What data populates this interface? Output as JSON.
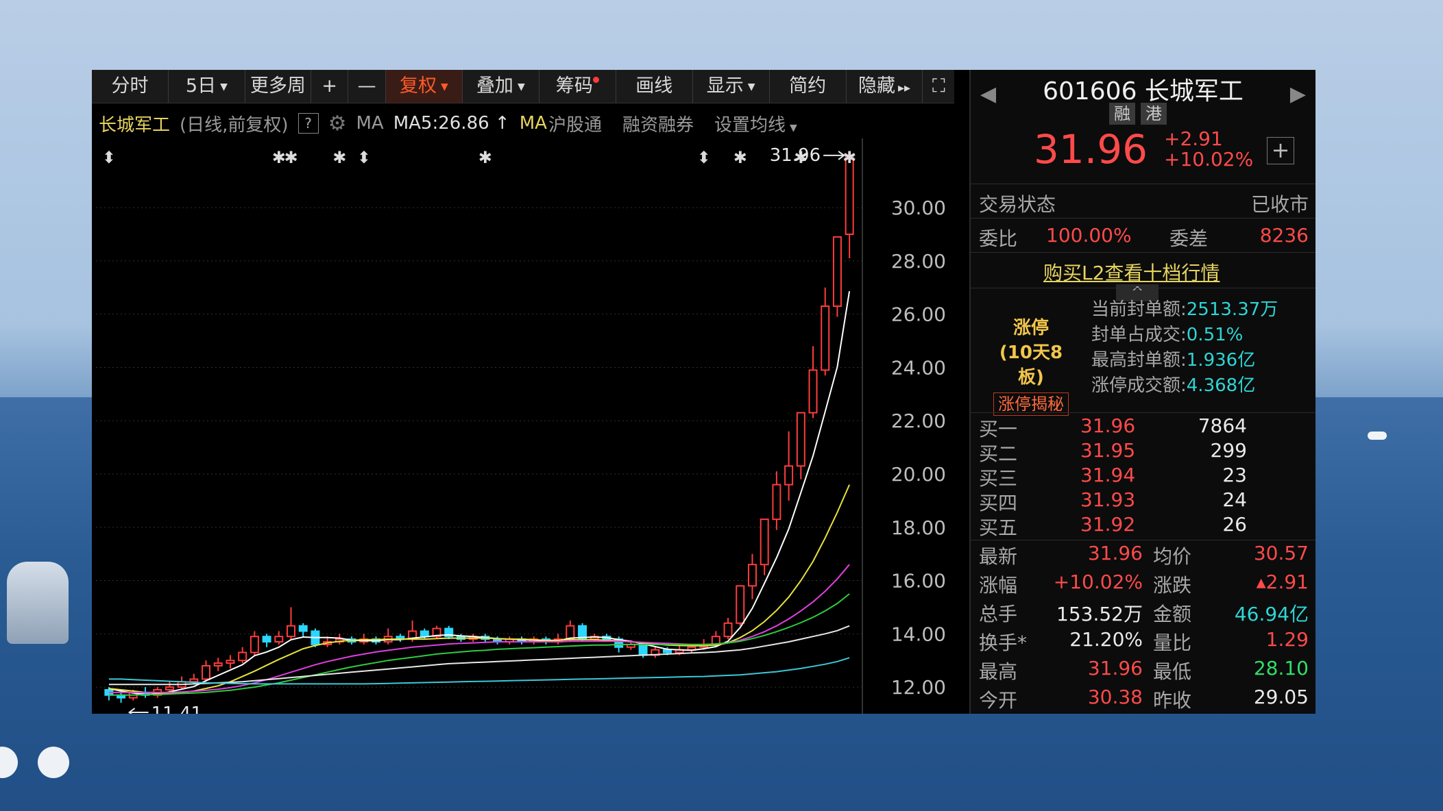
{
  "toolbar": {
    "fenshi": "分时",
    "fiveday": "5日",
    "more": "更多周",
    "plus": "+",
    "minus": "—",
    "fuquan": "复权",
    "overlay": "叠加",
    "chouma": "筹码",
    "draw": "画线",
    "display": "显示",
    "simple": "简约",
    "hide": "隐藏",
    "hide_arrows": "▸▸",
    "expand": "⛶"
  },
  "info": {
    "name": "长城军工",
    "sub": "(日线,前复权)",
    "help": "?",
    "ma_label": "MA",
    "ma5": "MA5:26.86",
    "ma5_arrow": "↑",
    "ma_yellow": "MA",
    "hgt": "沪股通",
    "margin": "融资融券",
    "set_ma": "设置均线"
  },
  "chart_data": {
    "type": "candlestick",
    "ylim": [
      11,
      32.6
    ],
    "y_ticks": [
      "30.00",
      "28.00",
      "26.00",
      "24.00",
      "22.00",
      "20.00",
      "18.00",
      "16.00",
      "14.00",
      "12.00"
    ],
    "y_tick_values": [
      30,
      28,
      26,
      24,
      22,
      20,
      18,
      16,
      14,
      12
    ],
    "last_label": "31.96",
    "low_label": "11.41",
    "candles": [
      [
        11.9,
        11.7,
        12.0,
        11.5
      ],
      [
        11.7,
        11.6,
        11.8,
        11.41
      ],
      [
        11.6,
        11.8,
        11.9,
        11.5
      ],
      [
        11.8,
        11.7,
        12.0,
        11.6
      ],
      [
        11.7,
        11.9,
        12.0,
        11.6
      ],
      [
        11.9,
        12.0,
        12.2,
        11.8
      ],
      [
        12.0,
        12.2,
        12.4,
        11.9
      ],
      [
        12.2,
        12.3,
        12.5,
        12.1
      ],
      [
        12.3,
        12.8,
        13.0,
        12.2
      ],
      [
        12.8,
        12.9,
        13.1,
        12.6
      ],
      [
        12.9,
        13.0,
        13.2,
        12.7
      ],
      [
        13.0,
        13.3,
        13.5,
        12.9
      ],
      [
        13.3,
        13.9,
        14.1,
        13.2
      ],
      [
        13.9,
        13.7,
        14.0,
        13.5
      ],
      [
        13.7,
        13.9,
        14.1,
        13.6
      ],
      [
        13.9,
        14.3,
        15.0,
        13.8
      ],
      [
        14.3,
        14.1,
        14.4,
        13.9
      ],
      [
        14.1,
        13.6,
        14.2,
        13.5
      ],
      [
        13.6,
        13.7,
        13.9,
        13.5
      ],
      [
        13.7,
        13.8,
        14.0,
        13.6
      ],
      [
        13.8,
        13.7,
        13.9,
        13.6
      ],
      [
        13.7,
        13.8,
        14.0,
        13.6
      ],
      [
        13.8,
        13.7,
        13.9,
        13.6
      ],
      [
        13.7,
        13.9,
        14.2,
        13.6
      ],
      [
        13.9,
        13.8,
        14.0,
        13.7
      ],
      [
        13.8,
        14.1,
        14.5,
        13.7
      ],
      [
        14.1,
        13.9,
        14.2,
        13.8
      ],
      [
        13.9,
        14.2,
        14.3,
        13.8
      ],
      [
        14.2,
        13.9,
        14.3,
        13.8
      ],
      [
        13.9,
        13.8,
        14.0,
        13.7
      ],
      [
        13.8,
        13.9,
        14.0,
        13.7
      ],
      [
        13.9,
        13.8,
        14.0,
        13.7
      ],
      [
        13.8,
        13.7,
        13.9,
        13.6
      ],
      [
        13.7,
        13.8,
        13.9,
        13.6
      ],
      [
        13.8,
        13.7,
        13.9,
        13.6
      ],
      [
        13.7,
        13.8,
        13.9,
        13.6
      ],
      [
        13.8,
        13.7,
        13.9,
        13.6
      ],
      [
        13.7,
        13.8,
        14.0,
        13.6
      ],
      [
        13.8,
        14.3,
        14.5,
        13.7
      ],
      [
        14.3,
        13.8,
        14.4,
        13.7
      ],
      [
        13.8,
        13.9,
        14.0,
        13.7
      ],
      [
        13.9,
        13.8,
        14.0,
        13.7
      ],
      [
        13.8,
        13.5,
        13.9,
        13.3
      ],
      [
        13.5,
        13.6,
        13.7,
        13.4
      ],
      [
        13.6,
        13.2,
        13.7,
        13.1
      ],
      [
        13.2,
        13.4,
        13.5,
        13.1
      ],
      [
        13.4,
        13.3,
        13.5,
        13.2
      ],
      [
        13.3,
        13.4,
        13.6,
        13.2
      ],
      [
        13.4,
        13.5,
        13.6,
        13.3
      ],
      [
        13.5,
        13.6,
        13.8,
        13.4
      ],
      [
        13.6,
        13.9,
        14.1,
        13.5
      ],
      [
        13.9,
        14.4,
        14.6,
        13.8
      ],
      [
        14.4,
        15.8,
        15.8,
        14.3
      ],
      [
        15.8,
        16.6,
        17.0,
        15.3
      ],
      [
        16.6,
        18.3,
        18.3,
        16.2
      ],
      [
        18.3,
        19.6,
        20.1,
        17.9
      ],
      [
        19.6,
        20.3,
        21.6,
        19.0
      ],
      [
        20.3,
        22.3,
        22.3,
        19.8
      ],
      [
        22.3,
        23.9,
        24.8,
        22.1
      ],
      [
        23.9,
        26.3,
        27.0,
        23.7
      ],
      [
        26.3,
        28.9,
        28.9,
        25.9
      ],
      [
        29.0,
        31.96,
        31.96,
        28.1
      ]
    ],
    "ma_series": [
      {
        "color": "#ffffff",
        "values": [
          11.95,
          11.85,
          11.78,
          11.72,
          11.74,
          11.82,
          11.92,
          12.02,
          12.24,
          12.44,
          12.64,
          12.84,
          13.18,
          13.32,
          13.5,
          13.78,
          13.88,
          13.86,
          13.86,
          13.84,
          13.76,
          13.74,
          13.74,
          13.78,
          13.78,
          13.84,
          13.88,
          13.94,
          13.96,
          13.92,
          13.9,
          13.86,
          13.82,
          13.8,
          13.78,
          13.76,
          13.74,
          13.74,
          13.84,
          13.86,
          13.88,
          13.86,
          13.78,
          13.72,
          13.62,
          13.52,
          13.42,
          13.4,
          13.38,
          13.44,
          13.52,
          13.72,
          14.24,
          14.96,
          15.9,
          16.86,
          17.94,
          19.3,
          20.68,
          22.34,
          24.02,
          26.86
        ]
      },
      {
        "color": "#e8e33c",
        "values": [
          11.95,
          11.9,
          11.85,
          11.8,
          11.78,
          11.78,
          11.8,
          11.85,
          11.95,
          12.05,
          12.2,
          12.4,
          12.6,
          12.82,
          13.04,
          13.24,
          13.44,
          13.56,
          13.66,
          13.72,
          13.76,
          13.78,
          13.78,
          13.8,
          13.8,
          13.8,
          13.8,
          13.82,
          13.84,
          13.84,
          13.84,
          13.84,
          13.82,
          13.8,
          13.8,
          13.78,
          13.76,
          13.76,
          13.78,
          13.78,
          13.78,
          13.76,
          13.74,
          13.7,
          13.66,
          13.62,
          13.58,
          13.56,
          13.55,
          13.55,
          13.58,
          13.66,
          13.86,
          14.12,
          14.46,
          14.88,
          15.38,
          16.0,
          16.72,
          17.6,
          18.56,
          19.6
        ]
      },
      {
        "color": "#e040e0",
        "values": [
          11.8,
          11.8,
          11.8,
          11.8,
          11.8,
          11.8,
          11.82,
          11.84,
          11.88,
          11.92,
          11.98,
          12.06,
          12.16,
          12.28,
          12.42,
          12.56,
          12.7,
          12.84,
          12.96,
          13.06,
          13.16,
          13.24,
          13.32,
          13.38,
          13.44,
          13.5,
          13.54,
          13.58,
          13.62,
          13.64,
          13.66,
          13.68,
          13.7,
          13.7,
          13.7,
          13.7,
          13.7,
          13.7,
          13.72,
          13.72,
          13.72,
          13.72,
          13.72,
          13.7,
          13.68,
          13.66,
          13.64,
          13.62,
          13.6,
          13.6,
          13.62,
          13.66,
          13.76,
          13.9,
          14.08,
          14.3,
          14.56,
          14.86,
          15.2,
          15.6,
          16.06,
          16.6
        ]
      },
      {
        "color": "#2ecc40",
        "values": [
          11.7,
          11.7,
          11.7,
          11.72,
          11.72,
          11.74,
          11.76,
          11.78,
          11.8,
          11.84,
          11.88,
          11.94,
          12.0,
          12.08,
          12.16,
          12.26,
          12.36,
          12.46,
          12.56,
          12.66,
          12.76,
          12.84,
          12.92,
          13.0,
          13.06,
          13.12,
          13.18,
          13.24,
          13.28,
          13.32,
          13.36,
          13.38,
          13.42,
          13.44,
          13.46,
          13.48,
          13.5,
          13.52,
          13.54,
          13.56,
          13.58,
          13.58,
          13.6,
          13.6,
          13.6,
          13.6,
          13.6,
          13.6,
          13.6,
          13.6,
          13.62,
          13.66,
          13.72,
          13.82,
          13.94,
          14.08,
          14.24,
          14.42,
          14.62,
          14.86,
          15.14,
          15.5
        ]
      },
      {
        "color": "#e8e8e8",
        "values": [
          12.1,
          12.1,
          12.1,
          12.1,
          12.1,
          12.1,
          12.1,
          12.12,
          12.14,
          12.16,
          12.18,
          12.2,
          12.24,
          12.28,
          12.32,
          12.36,
          12.4,
          12.44,
          12.48,
          12.52,
          12.56,
          12.6,
          12.64,
          12.68,
          12.72,
          12.76,
          12.8,
          12.84,
          12.88,
          12.9,
          12.92,
          12.94,
          12.96,
          12.98,
          13.0,
          13.02,
          13.04,
          13.06,
          13.08,
          13.1,
          13.12,
          13.14,
          13.16,
          13.18,
          13.2,
          13.22,
          13.24,
          13.26,
          13.28,
          13.3,
          13.32,
          13.36,
          13.4,
          13.46,
          13.54,
          13.62,
          13.7,
          13.8,
          13.9,
          14.0,
          14.12,
          14.3
        ]
      },
      {
        "color": "#3cc8d8",
        "values": [
          12.3,
          12.3,
          12.28,
          12.26,
          12.24,
          12.22,
          12.2,
          12.18,
          12.16,
          12.15,
          12.14,
          12.13,
          12.12,
          12.12,
          12.12,
          12.12,
          12.12,
          12.12,
          12.12,
          12.12,
          12.12,
          12.12,
          12.13,
          12.14,
          12.15,
          12.16,
          12.17,
          12.18,
          12.19,
          12.2,
          12.21,
          12.22,
          12.23,
          12.24,
          12.25,
          12.26,
          12.27,
          12.28,
          12.29,
          12.3,
          12.31,
          12.32,
          12.33,
          12.34,
          12.35,
          12.36,
          12.37,
          12.38,
          12.39,
          12.4,
          12.42,
          12.44,
          12.46,
          12.5,
          12.54,
          12.58,
          12.64,
          12.7,
          12.78,
          12.86,
          12.96,
          13.1
        ]
      }
    ],
    "event_markers": [
      {
        "index": 0,
        "glyph": "⬍"
      },
      {
        "index": 14,
        "glyph": "✱"
      },
      {
        "index": 15,
        "glyph": "✱"
      },
      {
        "index": 19,
        "glyph": "✱"
      },
      {
        "index": 21,
        "glyph": "⬍"
      },
      {
        "index": 31,
        "glyph": "✱"
      },
      {
        "index": 49,
        "glyph": "⬍"
      },
      {
        "index": 52,
        "glyph": "✱"
      },
      {
        "index": 57,
        "glyph": "✱"
      },
      {
        "index": 61,
        "glyph": "✱"
      }
    ]
  },
  "panel": {
    "code": "601606 长城军工",
    "left_arrow": "◀",
    "right_arrow": "▶",
    "tag_rong": "融",
    "tag_gang": "港",
    "price": "31.96",
    "change": "+2.91",
    "change_pct": "+10.02%",
    "plus": "+",
    "status_label": "交易状态",
    "status_value": "已收市",
    "weibi_label": "委比",
    "weibi_value": "100.00%",
    "weicha_label": "委差",
    "weicha_value": "8236",
    "l2_link": "购买L2查看十档行情",
    "collapse": "^",
    "zt_title": "涨停",
    "zt_sub": "(10天8板)",
    "zt_btn": "涨停揭秘",
    "zt_rows": [
      {
        "label": "当前封单额:",
        "value": "2513.37万"
      },
      {
        "label": "封单占成交:",
        "value": "0.51%"
      },
      {
        "label": "最高封单额:",
        "value": "1.936亿"
      },
      {
        "label": "涨停成交额:",
        "value": "4.368亿"
      }
    ],
    "book": [
      {
        "label": "买一",
        "price": "31.96",
        "vol": "7864"
      },
      {
        "label": "买二",
        "price": "31.95",
        "vol": "299"
      },
      {
        "label": "买三",
        "price": "31.94",
        "vol": "23"
      },
      {
        "label": "买四",
        "price": "31.93",
        "vol": "24"
      },
      {
        "label": "买五",
        "price": "31.92",
        "vol": "26"
      }
    ],
    "quotes": [
      {
        "l1": "最新",
        "v1": "31.96",
        "c1": "red",
        "l2": "均价",
        "v2": "30.57",
        "c2": "red"
      },
      {
        "l1": "涨幅",
        "v1": "+10.02%",
        "c1": "red",
        "l2": "涨跌",
        "v2": "▴2.91",
        "c2": "red"
      },
      {
        "l1": "总手",
        "v1": "153.52万",
        "c1": "wh",
        "l2": "金额",
        "v2": "46.94亿",
        "c2": "cyan"
      },
      {
        "l1": "换手*",
        "v1": "21.20%",
        "c1": "wh",
        "l2": "量比",
        "v2": "1.29",
        "c2": "red"
      },
      {
        "l1": "最高",
        "v1": "31.96",
        "c1": "red",
        "l2": "最低",
        "v2": "28.10",
        "c2": "grn"
      },
      {
        "l1": "今开",
        "v1": "30.38",
        "c1": "red",
        "l2": "昨收",
        "v2": "29.05",
        "c2": "wh"
      }
    ]
  }
}
